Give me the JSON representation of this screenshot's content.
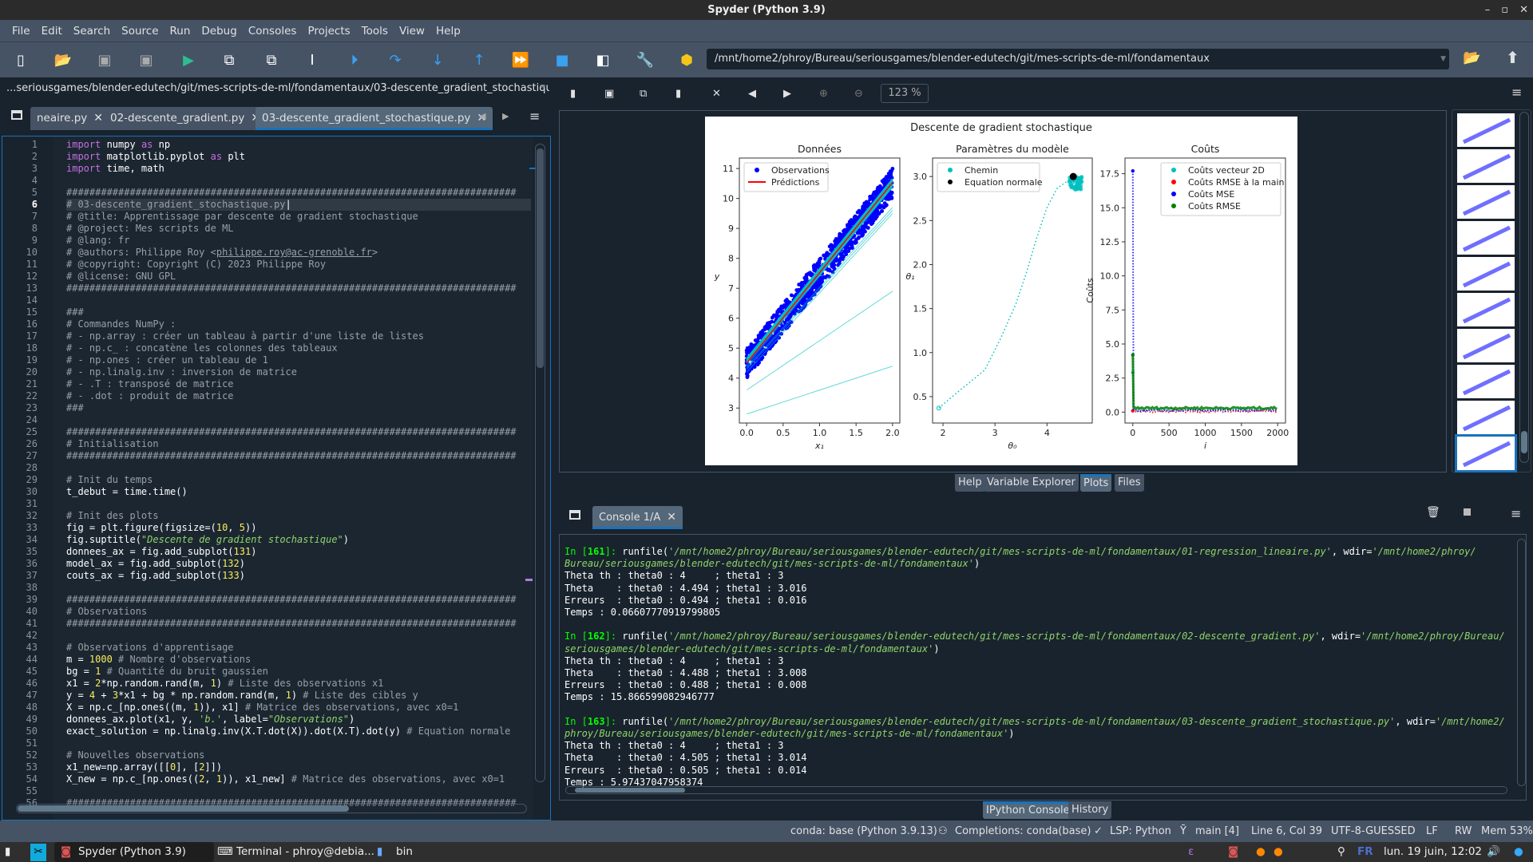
{
  "window": {
    "title": "Spyder (Python 3.9)"
  },
  "menu": [
    "File",
    "Edit",
    "Search",
    "Source",
    "Run",
    "Debug",
    "Consoles",
    "Projects",
    "Tools",
    "View",
    "Help"
  ],
  "toolbar": {
    "icons": [
      "new-file",
      "open-file",
      "save",
      "save-all",
      "run",
      "run-cell",
      "run-cell-advance",
      "run-selection",
      "debug",
      "step",
      "step-into",
      "step-out",
      "continue",
      "stop",
      "maximize-pane",
      "preferences",
      "python-path-manager"
    ],
    "working_dir": "/mnt/home2/phroy/Bureau/seriousgames/blender-edutech/git/mes-scripts-de-ml/fondamentaux"
  },
  "editor": {
    "path": "...seriousgames/blender-edutech/git/mes-scripts-de-ml/fondamentaux/03-descente_gradient_stochastique.py",
    "tabs": [
      {
        "label": "neaire.py"
      },
      {
        "label": "02-descente_gradient.py"
      },
      {
        "label": "03-descente_gradient_stochastique.py",
        "active": true
      }
    ],
    "current_line": 6,
    "lines": [
      [
        [
          "k",
          "import"
        ],
        [
          "t",
          " numpy "
        ],
        [
          "k",
          "as"
        ],
        [
          "t",
          " np"
        ]
      ],
      [
        [
          "k",
          "import"
        ],
        [
          "t",
          " matplotlib.pyplot "
        ],
        [
          "k",
          "as"
        ],
        [
          "t",
          " plt"
        ]
      ],
      [
        [
          "k",
          "import"
        ],
        [
          "t",
          " time, math"
        ]
      ],
      [],
      [
        [
          "c",
          "##############################################################################"
        ]
      ],
      [
        [
          "c",
          "# 03-descente_gradient_stochastique.py"
        ]
      ],
      [
        [
          "c",
          "# @title: Apprentissage par descente de gradient stochastique"
        ]
      ],
      [
        [
          "c",
          "# @project: Mes scripts de ML"
        ]
      ],
      [
        [
          "c",
          "# @lang: fr"
        ]
      ],
      [
        [
          "c",
          "# @authors: Philippe Roy <"
        ],
        [
          "cu",
          "philippe.roy@ac-grenoble.fr"
        ],
        [
          "c",
          ">"
        ]
      ],
      [
        [
          "c",
          "# @copyright: Copyright (C) 2023 Philippe Roy"
        ]
      ],
      [
        [
          "c",
          "# @license: GNU GPL"
        ]
      ],
      [
        [
          "c",
          "##############################################################################"
        ]
      ],
      [],
      [
        [
          "c",
          "###"
        ]
      ],
      [
        [
          "c",
          "# Commandes NumPy :"
        ]
      ],
      [
        [
          "c",
          "# - np.array : créer un tableau à partir d'une liste de listes"
        ]
      ],
      [
        [
          "c",
          "# - np.c_ : concatène les colonnes des tableaux"
        ]
      ],
      [
        [
          "c",
          "# - np.ones : créer un tableau de 1"
        ]
      ],
      [
        [
          "c",
          "# - np.linalg.inv : inversion de matrice"
        ]
      ],
      [
        [
          "c",
          "# - .T : transposé de matrice"
        ]
      ],
      [
        [
          "c",
          "# - .dot : produit de matrice"
        ]
      ],
      [
        [
          "c",
          "###"
        ]
      ],
      [],
      [
        [
          "c",
          "##############################################################################"
        ]
      ],
      [
        [
          "c",
          "# Initialisation"
        ]
      ],
      [
        [
          "c",
          "##############################################################################"
        ]
      ],
      [],
      [
        [
          "c",
          "# Init du temps"
        ]
      ],
      [
        [
          "t",
          "t_debut = time.time()"
        ]
      ],
      [],
      [
        [
          "c",
          "# Init des plots"
        ]
      ],
      [
        [
          "t",
          "fig = plt.figure(figsize=("
        ],
        [
          "n",
          "10"
        ],
        [
          "t",
          ", "
        ],
        [
          "n",
          "5"
        ],
        [
          "t",
          "))"
        ]
      ],
      [
        [
          "t",
          "fig.suptitle("
        ],
        [
          "s",
          "\"Descente de gradient stochastique\""
        ],
        [
          "t",
          ")"
        ]
      ],
      [
        [
          "t",
          "donnees_ax = fig.add_subplot("
        ],
        [
          "n",
          "131"
        ],
        [
          "t",
          ")"
        ]
      ],
      [
        [
          "t",
          "model_ax = fig.add_subplot("
        ],
        [
          "n",
          "132"
        ],
        [
          "t",
          ")"
        ]
      ],
      [
        [
          "t",
          "couts_ax = fig.add_subplot("
        ],
        [
          "n",
          "133"
        ],
        [
          "t",
          ")"
        ]
      ],
      [],
      [
        [
          "c",
          "##############################################################################"
        ]
      ],
      [
        [
          "c",
          "# Observations"
        ]
      ],
      [
        [
          "c",
          "##############################################################################"
        ]
      ],
      [],
      [
        [
          "c",
          "# Observations d'apprentisage"
        ]
      ],
      [
        [
          "t",
          "m = "
        ],
        [
          "n",
          "1000"
        ],
        [
          "c",
          " # Nombre d'observations"
        ]
      ],
      [
        [
          "t",
          "bg = "
        ],
        [
          "n",
          "1"
        ],
        [
          "c",
          " # Quantité du bruit gaussien"
        ]
      ],
      [
        [
          "t",
          "x1 = "
        ],
        [
          "n",
          "2"
        ],
        [
          "t",
          "*np.random.rand(m, "
        ],
        [
          "n",
          "1"
        ],
        [
          "t",
          ")"
        ],
        [
          "c",
          " # Liste des observations x1"
        ]
      ],
      [
        [
          "t",
          "y = "
        ],
        [
          "n",
          "4"
        ],
        [
          "t",
          " + "
        ],
        [
          "n",
          "3"
        ],
        [
          "t",
          "*x1 + bg * np.random.rand(m, "
        ],
        [
          "n",
          "1"
        ],
        [
          "t",
          ")"
        ],
        [
          "c",
          " # Liste des cibles y"
        ]
      ],
      [
        [
          "t",
          "X = np.c_[np.ones((m, "
        ],
        [
          "n",
          "1"
        ],
        [
          "t",
          ")), x1]"
        ],
        [
          "c",
          " # Matrice des observations, avec x0=1"
        ]
      ],
      [
        [
          "t",
          "donnees_ax.plot(x1, y, "
        ],
        [
          "s",
          "'b.'"
        ],
        [
          "t",
          ", label="
        ],
        [
          "s",
          "\"Observations\""
        ],
        [
          "t",
          ")"
        ]
      ],
      [
        [
          "t",
          "exact_solution = np.linalg.inv(X.T.dot(X)).dot(X.T).dot(y)"
        ],
        [
          "c",
          " # Equation normale"
        ]
      ],
      [],
      [
        [
          "c",
          "# Nouvelles observations"
        ]
      ],
      [
        [
          "t",
          "x1_new=np.array([["
        ],
        [
          "n",
          "0"
        ],
        [
          "t",
          "], ["
        ],
        [
          "n",
          "2"
        ],
        [
          "t",
          "]])"
        ]
      ],
      [
        [
          "t",
          "X_new = np.c_[np.ones(("
        ],
        [
          "n",
          "2"
        ],
        [
          "t",
          ", "
        ],
        [
          "n",
          "1"
        ],
        [
          "t",
          ")), x1_new]"
        ],
        [
          "c",
          " # Matrice des observations, avec x0=1"
        ]
      ],
      [],
      [
        [
          "c",
          "##############################################################################"
        ]
      ]
    ]
  },
  "plots": {
    "zoom": "123 %",
    "pane_tabs": [
      {
        "label": "Help"
      },
      {
        "label": "Variable Explorer"
      },
      {
        "label": "Plots",
        "active": true
      },
      {
        "label": "Files"
      }
    ],
    "thumbnail_count": 10
  },
  "chart_data": [
    {
      "type": "scatter",
      "suptitle": "Descente de gradient stochastique",
      "title": "Données",
      "xlabel": "x₁",
      "ylabel": "y",
      "xlim": [
        -0.1,
        2.1
      ],
      "ylim": [
        2.5,
        11.35
      ],
      "xticks": [
        "0.0",
        "0.5",
        "1.0",
        "1.5",
        "2.0"
      ],
      "yticks": [
        "3",
        "4",
        "5",
        "6",
        "7",
        "8",
        "9",
        "10",
        "11"
      ],
      "legend": [
        "Observations",
        "Prédictions"
      ],
      "legend_placement": "top-left",
      "observations": {
        "model": "y = 4 + 3·x1 + noise",
        "x_range": [
          0,
          2
        ],
        "noise_range": [
          0,
          1
        ],
        "count": 1000,
        "color": "#0000ff"
      },
      "prediction": {
        "x": [
          0,
          2
        ],
        "y": [
          4.505,
          10.533
        ],
        "color": "#ff0000"
      },
      "path_lines": [
        {
          "x": [
            0,
            2
          ],
          "y": [
            2.8,
            4.4
          ]
        },
        {
          "x": [
            0,
            2
          ],
          "y": [
            3.6,
            6.9
          ]
        },
        {
          "x": [
            0,
            2
          ],
          "y": [
            4.2,
            9.5
          ]
        },
        {
          "x": [
            0,
            2
          ],
          "y": [
            4.3,
            9.6
          ]
        },
        {
          "x": [
            0,
            2
          ],
          "y": [
            4.35,
            9.7
          ]
        },
        {
          "x": [
            0,
            2
          ],
          "y": [
            4.6,
            10.6
          ]
        },
        {
          "x": [
            0,
            2
          ],
          "y": [
            4.4,
            10.4
          ]
        }
      ]
    },
    {
      "type": "line",
      "title": "Paramètres du modèle",
      "xlabel": "θ₀",
      "ylabel": "θ₁",
      "xlim": [
        1.8,
        4.87
      ],
      "ylim": [
        0.2,
        3.21
      ],
      "xticks": [
        "2",
        "3",
        "4"
      ],
      "yticks": [
        "0.5",
        "1.0",
        "1.5",
        "2.0",
        "2.5",
        "3.0"
      ],
      "legend": [
        "Chemin",
        "Equation normale"
      ],
      "legend_placement": "top-left",
      "path": {
        "x": [
          1.92,
          2.3,
          2.8,
          3.1,
          3.4,
          3.6,
          3.8,
          4.0,
          4.2,
          4.4,
          4.5
        ],
        "y": [
          0.37,
          0.56,
          0.8,
          1.15,
          1.55,
          1.9,
          2.3,
          2.65,
          2.87,
          2.95,
          3.0
        ],
        "color": "#00bfbf"
      },
      "normal_equation": {
        "theta0": 4.505,
        "theta1": 3.0,
        "color": "#000000"
      }
    },
    {
      "type": "line",
      "title": "Coûts",
      "xlabel": "i",
      "ylabel": "Coûts",
      "xlim": [
        -108,
        2108
      ],
      "ylim": [
        -0.8,
        18.65
      ],
      "xticks": [
        "0",
        "500",
        "1000",
        "1500",
        "2000"
      ],
      "yticks": [
        "0.0",
        "2.5",
        "5.0",
        "7.5",
        "10.0",
        "12.5",
        "15.0",
        "17.5"
      ],
      "legend_placement": "top-right",
      "series": [
        {
          "name": "Coûts vecteur 2D",
          "color": "#00bfbf",
          "start": 2.9,
          "level": 0.2
        },
        {
          "name": "Coûts RMSE à la main",
          "color": "#ff0000",
          "start": 0.1,
          "level": 0.05
        },
        {
          "name": "Coûts MSE",
          "color": "#0000ff",
          "start": 17.7,
          "level": 0.12
        },
        {
          "name": "Coûts RMSE",
          "color": "#008000",
          "start": 4.2,
          "level": 0.3
        }
      ]
    }
  ],
  "console": {
    "tab": "Console 1/A",
    "lines": [
      [
        [
          "pin",
          "In ["
        ],
        [
          "pnum",
          "161"
        ],
        [
          "pin",
          "]: "
        ],
        [
          "t",
          "runfile("
        ],
        [
          "cstr",
          "'/mnt/home2/phroy/Bureau/seriousgames/blender-edutech/git/mes-scripts-de-ml/fondamentaux/01-regression_lineaire.py'"
        ],
        [
          "t",
          ", wdir="
        ],
        [
          "cstr",
          "'/mnt/home2/phroy/"
        ]
      ],
      [
        [
          "cstr",
          "Bureau/seriousgames/blender-edutech/git/mes-scripts-de-ml/fondamentaux'"
        ],
        [
          "t",
          ")"
        ]
      ],
      [
        [
          "t",
          "Theta th : theta0 : 4     ; theta1 : 3"
        ]
      ],
      [
        [
          "t",
          "Theta    : theta0 : 4.494 ; theta1 : 3.016"
        ]
      ],
      [
        [
          "t",
          "Erreurs  : theta0 : 0.494 ; theta1 : 0.016"
        ]
      ],
      [
        [
          "t",
          "Temps : 0.06607770919799805"
        ]
      ],
      [],
      [
        [
          "pin",
          "In ["
        ],
        [
          "pnum",
          "162"
        ],
        [
          "pin",
          "]: "
        ],
        [
          "t",
          "runfile("
        ],
        [
          "cstr",
          "'/mnt/home2/phroy/Bureau/seriousgames/blender-edutech/git/mes-scripts-de-ml/fondamentaux/02-descente_gradient.py'"
        ],
        [
          "t",
          ", wdir="
        ],
        [
          "cstr",
          "'/mnt/home2/phroy/Bureau/"
        ]
      ],
      [
        [
          "cstr",
          "seriousgames/blender-edutech/git/mes-scripts-de-ml/fondamentaux'"
        ],
        [
          "t",
          ")"
        ]
      ],
      [
        [
          "t",
          "Theta th : theta0 : 4     ; theta1 : 3"
        ]
      ],
      [
        [
          "t",
          "Theta    : theta0 : 4.488 ; theta1 : 3.008"
        ]
      ],
      [
        [
          "t",
          "Erreurs  : theta0 : 0.488 ; theta1 : 0.008"
        ]
      ],
      [
        [
          "t",
          "Temps : 15.866599082946777"
        ]
      ],
      [],
      [
        [
          "pin",
          "In ["
        ],
        [
          "pnum",
          "163"
        ],
        [
          "pin",
          "]: "
        ],
        [
          "t",
          "runfile("
        ],
        [
          "cstr",
          "'/mnt/home2/phroy/Bureau/seriousgames/blender-edutech/git/mes-scripts-de-ml/fondamentaux/03-descente_gradient_stochastique.py'"
        ],
        [
          "t",
          ", wdir="
        ],
        [
          "cstr",
          "'/mnt/home2/"
        ]
      ],
      [
        [
          "cstr",
          "phroy/Bureau/seriousgames/blender-edutech/git/mes-scripts-de-ml/fondamentaux'"
        ],
        [
          "t",
          ")"
        ]
      ],
      [
        [
          "t",
          "Theta th : theta0 : 4     ; theta1 : 3"
        ]
      ],
      [
        [
          "t",
          "Theta    : theta0 : 4.505 ; theta1 : 3.014"
        ]
      ],
      [
        [
          "t",
          "Erreurs  : theta0 : 0.505 ; theta1 : 0.014"
        ]
      ],
      [
        [
          "t",
          "Temps : 5.97437047958374"
        ]
      ]
    ],
    "bottom_tabs": [
      {
        "label": "IPython Console",
        "active": true
      },
      {
        "label": "History"
      }
    ]
  },
  "status": {
    "conda": "conda: base (Python 3.9.13)",
    "completions": "Completions: conda(base)",
    "lsp": "LSP: Python",
    "git": "main [4]",
    "position": "Line 6, Col 39",
    "encoding": "UTF-8-GUESSED",
    "eol": "LF",
    "rw": "RW",
    "mem": "Mem 53%"
  },
  "taskbar": {
    "spyder": "Spyder (Python 3.9)",
    "terminal": "Terminal - phroy@debia...",
    "folder": "bin",
    "lang": "FR",
    "clock": "lun. 19 juin, 12:02"
  },
  "colors": {
    "accent": "#1A72BB",
    "bg": "#19232D",
    "panel": "#455364"
  }
}
